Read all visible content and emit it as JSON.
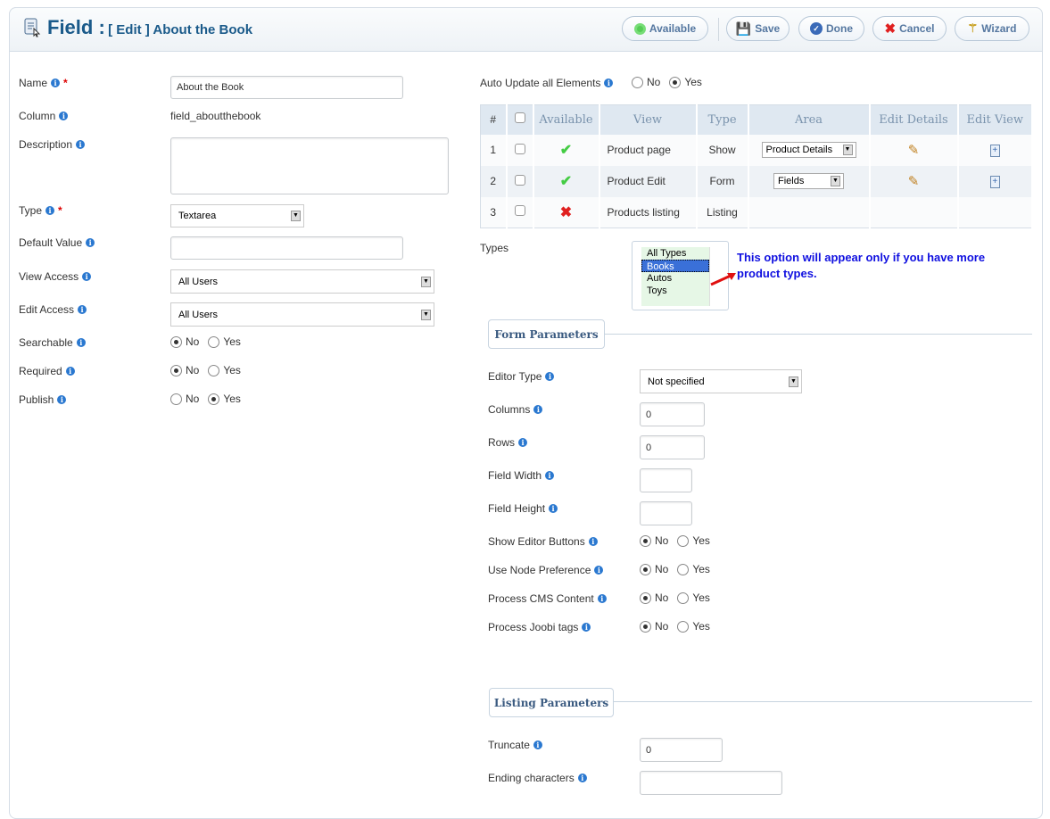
{
  "header": {
    "title": "Field :",
    "subtitle": "[ Edit ] About the Book",
    "buttons": [
      {
        "label": "Available",
        "icon": "available-icon"
      },
      {
        "label": "Save",
        "icon": "save-icon"
      },
      {
        "label": "Done",
        "icon": "done-icon"
      },
      {
        "label": "Cancel",
        "icon": "cancel-icon"
      },
      {
        "label": "Wizard",
        "icon": "wizard-icon"
      }
    ]
  },
  "left": {
    "name": {
      "label": "Name",
      "value": "About the Book"
    },
    "column": {
      "label": "Column",
      "value": "field_aboutthebook"
    },
    "description": {
      "label": "Description",
      "value": ""
    },
    "type": {
      "label": "Type",
      "value": "Textarea"
    },
    "default_value": {
      "label": "Default Value",
      "value": ""
    },
    "view_access": {
      "label": "View Access",
      "value": "All Users"
    },
    "edit_access": {
      "label": "Edit Access",
      "value": "All Users"
    },
    "searchable": {
      "label": "Searchable",
      "selected": "No"
    },
    "required": {
      "label": "Required",
      "selected": "No"
    },
    "publish": {
      "label": "Publish",
      "selected": "Yes"
    },
    "no": "No",
    "yes": "Yes"
  },
  "right": {
    "auto_update": {
      "label": "Auto Update all Elements",
      "selected": "Yes"
    },
    "table": {
      "headers": [
        "#",
        "",
        "Available",
        "View",
        "Type",
        "Area",
        "Edit Details",
        "Edit View"
      ],
      "rows": [
        {
          "num": "1",
          "available": true,
          "view": "Product page",
          "type": "Show",
          "area": "Product Details"
        },
        {
          "num": "2",
          "available": true,
          "view": "Product Edit",
          "type": "Form",
          "area": "Fields"
        },
        {
          "num": "3",
          "available": false,
          "view": "Products listing",
          "type": "Listing",
          "area": ""
        }
      ]
    },
    "types": {
      "label": "Types",
      "options": [
        "All Types",
        "Books",
        "Autos",
        "Toys"
      ],
      "selected": "Books",
      "note": "This option will appear only if you have more product types."
    },
    "form_params": {
      "legend": "Form Parameters",
      "editor_type": {
        "label": "Editor Type",
        "value": "Not specified"
      },
      "columns": {
        "label": "Columns",
        "value": "0"
      },
      "rows": {
        "label": "Rows",
        "value": "0"
      },
      "field_width": {
        "label": "Field Width",
        "value": ""
      },
      "field_height": {
        "label": "Field Height",
        "value": ""
      },
      "show_editor_buttons": {
        "label": "Show Editor Buttons",
        "selected": "No"
      },
      "use_node_preference": {
        "label": "Use Node Preference",
        "selected": "No"
      },
      "process_cms_content": {
        "label": "Process CMS Content",
        "selected": "No"
      },
      "process_joobi_tags": {
        "label": "Process Joobi tags",
        "selected": "No"
      }
    },
    "listing_params": {
      "legend": "Listing Parameters",
      "truncate": {
        "label": "Truncate",
        "value": "0"
      },
      "ending_characters": {
        "label": "Ending characters",
        "value": ""
      }
    }
  },
  "colors": {
    "title": "#1a5a8a",
    "note": "#1010e0",
    "accent": "#2a78d0"
  }
}
